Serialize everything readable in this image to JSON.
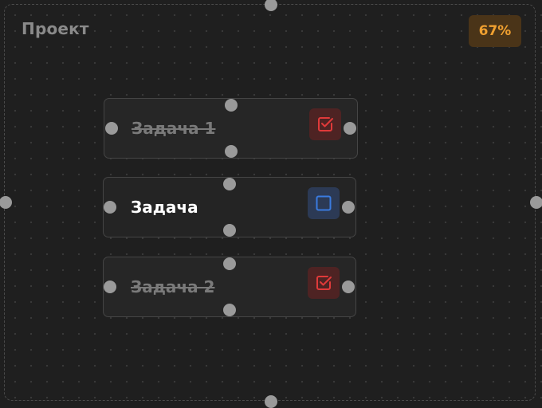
{
  "project": {
    "title": "Проект",
    "progress": "67%",
    "progress_value": 0.67
  },
  "tasks": [
    {
      "label": "Задача 1",
      "completed": true,
      "checkbox_icon": "checked-square-icon"
    },
    {
      "label": "Задача",
      "completed": false,
      "checkbox_icon": "empty-square-icon"
    },
    {
      "label": "Задача 2",
      "completed": true,
      "checkbox_icon": "checked-square-icon"
    }
  ],
  "colors": {
    "accent_progress": "#f0a030",
    "checked": "#e03a3a",
    "unchecked": "#3a7be0",
    "handle": "#9a9a9a"
  }
}
